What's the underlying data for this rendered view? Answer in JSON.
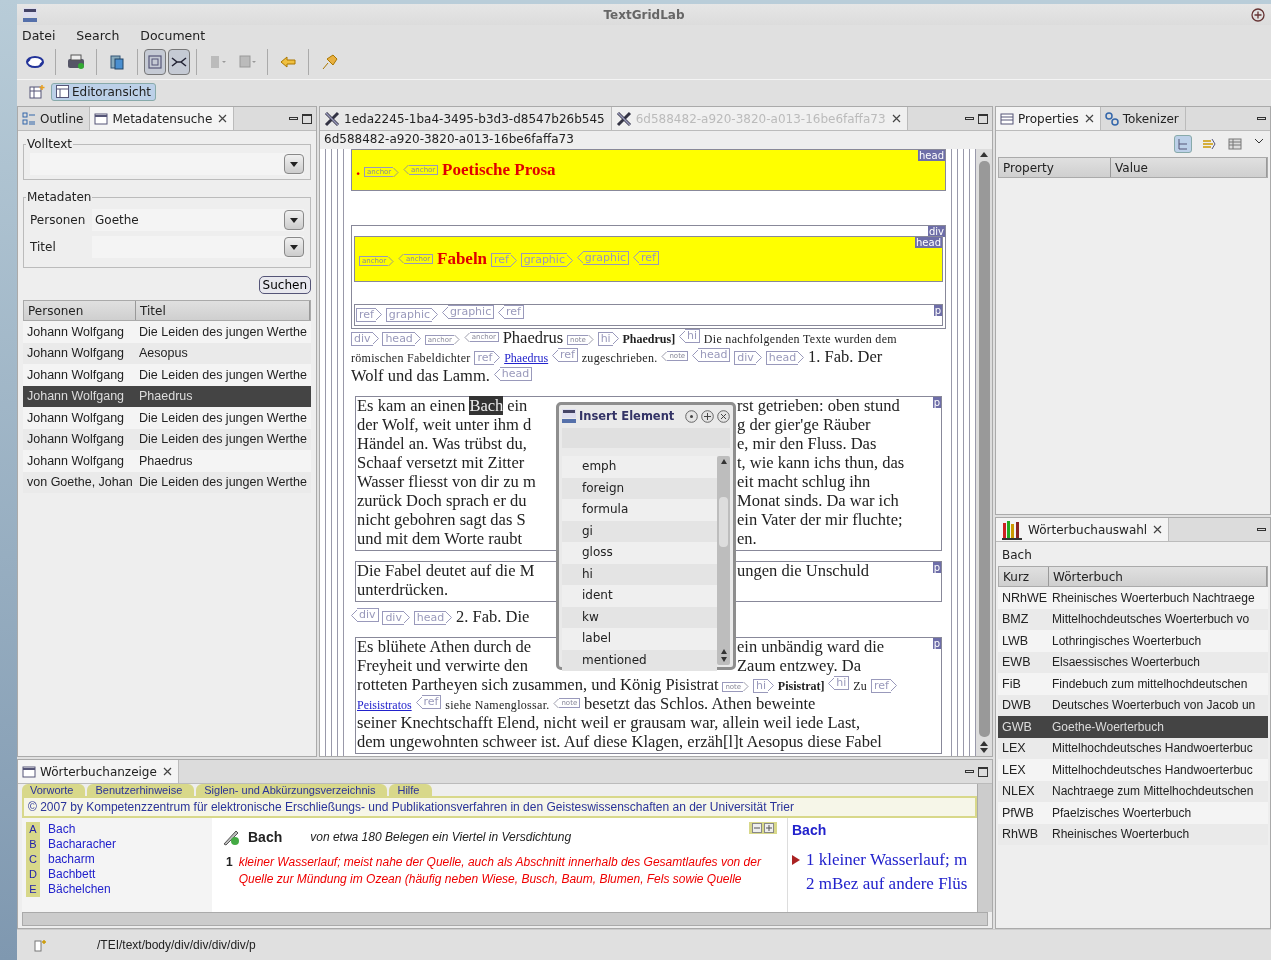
{
  "window": {
    "title": "TextGridLab"
  },
  "menu": [
    {
      "label": "Datei"
    },
    {
      "label": "Search"
    },
    {
      "label": "Document"
    }
  ],
  "toolbar": [
    {
      "kind": "sync",
      "pressed": false
    },
    {
      "kind": "print",
      "pressed": false
    },
    {
      "kind": "copy",
      "pressed": false
    },
    {
      "kind": "layout",
      "pressed": true
    },
    {
      "kind": "split",
      "pressed": true
    },
    {
      "kind": "tool",
      "pressed": false
    },
    {
      "kind": "tool2",
      "pressed": false
    },
    {
      "kind": "back",
      "pressed": false
    },
    {
      "kind": "pin",
      "pressed": false
    }
  ],
  "perspective": {
    "label": "Editoransicht",
    "selected": true
  },
  "left_panel": {
    "tabs": [
      {
        "label": "Outline",
        "selected": false
      },
      {
        "label": "Metadatensuche",
        "selected": true
      }
    ],
    "volltext": {
      "legend": "Volltext"
    },
    "metadaten": {
      "legend": "Metadaten",
      "fields": [
        {
          "label": "Personen",
          "value": "Goethe"
        },
        {
          "label": "Titel"
        }
      ]
    },
    "search_button": "Suchen",
    "table": {
      "columns": [
        "Personen",
        "Titel"
      ],
      "rows": [
        {
          "cells": [
            "Johann Wolfgang",
            "Die Leiden des jungen Werthe"
          ],
          "selected": false
        },
        {
          "cells": [
            "Johann Wolfgang",
            "Aesopus"
          ],
          "selected": false
        },
        {
          "cells": [
            "Johann Wolfgang",
            "Die Leiden des jungen Werthe"
          ],
          "selected": false
        },
        {
          "cells": [
            "Johann Wolfgang",
            "Phaedrus"
          ],
          "selected": true
        },
        {
          "cells": [
            "Johann Wolfgang",
            "Die Leiden des jungen Werthe"
          ],
          "selected": false
        },
        {
          "cells": [
            "Johann Wolfgang",
            "Die Leiden des jungen Werthe"
          ],
          "selected": false
        },
        {
          "cells": [
            "Johann Wolfgang",
            "Phaedrus"
          ],
          "selected": false
        },
        {
          "cells": [
            "von Goethe, Johan",
            "Die Leiden des jungen Werthe"
          ],
          "selected": false
        }
      ]
    }
  },
  "editor": {
    "tabs": [
      {
        "label": "1eda2245-1ba4-3495-b3d3-d8547b26b545",
        "selected": false
      },
      {
        "label": "6d588482-a920-3820-a013-16be6faffa73",
        "selected": true
      }
    ],
    "path": "6d588482-a920-3820-a013-16be6faffa73",
    "blocks": [
      {
        "kind": "head",
        "label": "head",
        "segments": [
          {
            "kind": "title",
            "text": "."
          },
          {
            "kind": "anchor",
            "closing": false,
            "text": "anchor"
          },
          {
            "kind": "anchor",
            "closing": true,
            "text": "anchor"
          },
          {
            "kind": "title",
            "text": "Poetische Prosa"
          }
        ]
      },
      {
        "kind": "div",
        "label": "div",
        "children": [
          {
            "kind": "head",
            "label": "head",
            "segments": [
              {
                "kind": "anchor",
                "closing": false,
                "text": "anchor"
              },
              {
                "kind": "anchor",
                "closing": true,
                "text": "anchor"
              },
              {
                "kind": "title",
                "text": "Fabeln"
              },
              {
                "kind": "tag",
                "closing": false,
                "text": "ref"
              },
              {
                "kind": "tag",
                "closing": false,
                "text": "graphic"
              },
              {
                "kind": "tag",
                "closing": true,
                "text": "graphic"
              },
              {
                "kind": "tag",
                "closing": true,
                "text": "ref"
              }
            ]
          },
          {
            "kind": "p",
            "label": "p",
            "segments": [
              {
                "kind": "tag",
                "closing": false,
                "text": "ref"
              },
              {
                "kind": "tag",
                "closing": false,
                "text": "graphic"
              },
              {
                "kind": "tag",
                "closing": true,
                "text": "graphic"
              },
              {
                "kind": "tag",
                "closing": true,
                "text": "ref"
              }
            ]
          }
        ]
      },
      {
        "kind": "flow",
        "segments": [
          {
            "kind": "tag",
            "closing": false,
            "text": "div"
          },
          {
            "kind": "tag",
            "closing": false,
            "text": "head"
          },
          {
            "kind": "anchor",
            "closing": false,
            "text": "anchor"
          },
          {
            "kind": "anchor",
            "closing": true,
            "text": "anchor"
          },
          {
            "kind": "big",
            "text": "Phaedrus"
          },
          {
            "kind": "anchor",
            "closing": false,
            "text": "note"
          },
          {
            "kind": "tag",
            "closing": false,
            "text": "hi"
          },
          {
            "kind": "bold",
            "text": "Phaedrus]"
          },
          {
            "kind": "tag",
            "closing": true,
            "text": "hi"
          },
          {
            "kind": "text",
            "text": "Die nachfolgenden Texte wurden dem"
          },
          {
            "kind": "text",
            "text": "römischen Fabeldichter"
          },
          {
            "kind": "tag",
            "closing": false,
            "text": "ref"
          },
          {
            "kind": "link",
            "text": "Phaedrus"
          },
          {
            "kind": "tag",
            "closing": true,
            "text": "ref"
          },
          {
            "kind": "text",
            "text": "zugeschrieben."
          },
          {
            "kind": "anchor",
            "closing": true,
            "text": "note"
          },
          {
            "kind": "tag",
            "closing": true,
            "text": "head"
          },
          {
            "kind": "tag",
            "closing": false,
            "text": "div"
          },
          {
            "kind": "tag",
            "closing": false,
            "text": "head"
          },
          {
            "kind": "big",
            "text": "1. Fab. Der"
          },
          {
            "kind": "big",
            "text": "Wolf und das Lamm."
          },
          {
            "kind": "tag",
            "closing": true,
            "text": "head"
          }
        ]
      },
      {
        "kind": "p",
        "label": "p",
        "lines": [
          {
            "left": [
              {
                "kind": "big",
                "text": "Es kam an einen"
              },
              {
                "kind": "mark",
                "text": "Bach"
              },
              {
                "kind": "big",
                "text": "ein"
              }
            ],
            "right": [
              {
                "kind": "big",
                "text": "rst getrieben: oben stund"
              }
            ]
          },
          {
            "left": [
              {
                "kind": "big",
                "text": "der Wolf, weit unter ihm d"
              }
            ],
            "right": [
              {
                "kind": "big",
                "text": "g der gier'ge Räuber"
              }
            ]
          },
          {
            "left": [
              {
                "kind": "big",
                "text": "Händel an. Was trübst du,"
              }
            ],
            "right": [
              {
                "kind": "big",
                "text": "e, mir den Fluss. Das"
              }
            ]
          },
          {
            "left": [
              {
                "kind": "big",
                "text": "Schaaf versetzt mit Zitter"
              }
            ],
            "right": [
              {
                "kind": "big",
                "text": "t, wie kann ichs thun, das"
              }
            ]
          },
          {
            "left": [
              {
                "kind": "big",
                "text": "Wasser fliesst von dir zu m"
              }
            ],
            "right": [
              {
                "kind": "big",
                "text": "eit macht schlug ihn"
              }
            ]
          },
          {
            "left": [
              {
                "kind": "big",
                "text": "zurück Doch sprach er du"
              }
            ],
            "right": [
              {
                "kind": "big",
                "text": "Monat sinds. Da war ich"
              }
            ]
          },
          {
            "left": [
              {
                "kind": "big",
                "text": "nicht gebohren sagt das S"
              }
            ],
            "right": [
              {
                "kind": "big",
                "text": "ein Vater der mir fluchte;"
              }
            ]
          },
          {
            "left": [
              {
                "kind": "big",
                "text": "und mit dem Worte raubt"
              }
            ],
            "right": [
              {
                "kind": "big",
                "text": "en."
              }
            ]
          }
        ]
      },
      {
        "kind": "p",
        "label": "p",
        "lines": [
          {
            "left": [
              {
                "kind": "big",
                "text": "Die Fabel deutet auf die M"
              }
            ],
            "right": [
              {
                "kind": "big",
                "text": "ungen die Unschuld"
              }
            ]
          },
          {
            "left": [
              {
                "kind": "big",
                "text": "unterdrücken."
              }
            ]
          }
        ]
      },
      {
        "kind": "flow",
        "segments": [
          {
            "kind": "tag",
            "closing": true,
            "text": "div"
          },
          {
            "kind": "tag",
            "closing": false,
            "text": "div"
          },
          {
            "kind": "tag",
            "closing": false,
            "text": "head"
          },
          {
            "kind": "big",
            "text": "2. Fab. Die"
          }
        ]
      },
      {
        "kind": "p",
        "label": "p",
        "lines": [
          {
            "left": [
              {
                "kind": "big",
                "text": "Es blühete Athen durch de"
              }
            ],
            "right": [
              {
                "kind": "big",
                "text": "ein unbändig ward die"
              }
            ]
          },
          {
            "left": [
              {
                "kind": "big",
                "text": "Freyheit und verwirte den"
              }
            ],
            "right": [
              {
                "kind": "big",
                "text": "Zaum entzwey. Da"
              }
            ]
          }
        ],
        "segments": [
          {
            "kind": "big",
            "text": "rotteten Partheyen sich zusammen, und König Pisistrat"
          },
          {
            "kind": "anchor",
            "closing": false,
            "text": "note"
          },
          {
            "kind": "tag",
            "closing": false,
            "text": "hi"
          },
          {
            "kind": "bold",
            "text": "Pisistrat]"
          },
          {
            "kind": "tag",
            "closing": true,
            "text": "hi"
          },
          {
            "kind": "text",
            "text": "Zu"
          },
          {
            "kind": "tag",
            "closing": false,
            "text": "ref"
          },
          {
            "kind": "link",
            "text": "Peisistratos"
          },
          {
            "kind": "tag",
            "closing": true,
            "text": "ref"
          },
          {
            "kind": "text",
            "text": "siehe Namenglossar."
          },
          {
            "kind": "anchor",
            "closing": true,
            "text": "note"
          },
          {
            "kind": "big",
            "text": "besetzt das Schlos. Athen beweinte"
          },
          {
            "kind": "big",
            "text": "seiner Knechtschafft Elend, nicht weil er grausam war, allein weil iede Last,"
          },
          {
            "kind": "big",
            "text": "dem ungewohnten schweer ist. Auf diese Klagen, erzäh[l]t Aesopus diese"
          },
          {
            "kind": "big",
            "text": "Fabel"
          }
        ]
      }
    ],
    "popup": {
      "title": "Insert Element",
      "items": [
        "emph",
        "foreign",
        "formula",
        "gi",
        "gloss",
        "hi",
        "ident",
        "kw",
        "label",
        "mentioned"
      ]
    }
  },
  "properties": {
    "tabs": [
      {
        "label": "Properties",
        "selected": true
      },
      {
        "label": "Tokenizer",
        "selected": false
      }
    ],
    "columns": [
      "Property",
      "Value"
    ]
  },
  "dictionary_select": {
    "tab": "Wörterbuchauswahl",
    "query": "Bach",
    "columns": [
      "Kurz",
      "Wörterbuch"
    ],
    "rows": [
      {
        "cells": [
          "NRhWE",
          "Rheinisches Woerterbuch Nachtraege"
        ],
        "selected": false
      },
      {
        "cells": [
          "BMZ",
          "Mittelhochdeutsches Woerterbuch vo"
        ],
        "selected": false
      },
      {
        "cells": [
          "LWB",
          "Lothringisches Woerterbuch"
        ],
        "selected": false
      },
      {
        "cells": [
          "EWB",
          "Elsaessisches Woerterbuch"
        ],
        "selected": false
      },
      {
        "cells": [
          "FiB",
          "Findebuch zum mittelhochdeutschen"
        ],
        "selected": false
      },
      {
        "cells": [
          "DWB",
          "Deutsches Woerterbuch von Jacob un"
        ],
        "selected": false
      },
      {
        "cells": [
          "GWB",
          "Goethe-Woerterbuch"
        ],
        "selected": true
      },
      {
        "cells": [
          "LEX",
          "Mittelhochdeutsches Handwoerterbuc"
        ],
        "selected": false
      },
      {
        "cells": [
          "LEX",
          "Mittelhochdeutsches Handwoerterbuc"
        ],
        "selected": false
      },
      {
        "cells": [
          "NLEX",
          "Nachtraege zum Mittelhochdeutschen"
        ],
        "selected": false
      },
      {
        "cells": [
          "PfWB",
          "Pfaelzisches Woerterbuch"
        ],
        "selected": false
      },
      {
        "cells": [
          "RhWB",
          "Rheinisches Woerterbuch"
        ],
        "selected": false
      }
    ]
  },
  "dictionary_view": {
    "tab": "Wörterbuchanzeige",
    "links": [
      "Vorworte",
      "Benutzerhinweise",
      "Siglen- und Abkürzungsverzeichnis",
      "Hilfe"
    ],
    "copyright": "© 2007 by Kompetenzzentrum für elektronische Erschließungs- und Publikationsverfahren in den Geisteswissenschaften an der Universität Trier",
    "lemmas": [
      {
        "letter": "A",
        "word": "Bach"
      },
      {
        "letter": "B",
        "word": "Bacharacher"
      },
      {
        "letter": "C",
        "word": "bacharm"
      },
      {
        "letter": "D",
        "word": "Bachbett"
      },
      {
        "letter": "E",
        "word": "Bächelchen"
      }
    ],
    "article": {
      "lemma": "Bach",
      "note": "von etwa 180 Belegen ein Viertel in Versdichtung",
      "sense_number": "1",
      "sense": "kleiner Wasserlauf; meist nahe der Quelle, auch als Abschnitt innerhalb des Gesamtlaufes von der Quelle zur Mündung im Ozean (häufig neben Wiese, Busch, Baum, Blumen, Fels sowie Quelle"
    },
    "outline": {
      "lemma": "Bach",
      "senses": [
        {
          "text": "1 kleiner Wasserlauf; m",
          "current": true
        },
        {
          "text": "2 mBez auf andere Flüs",
          "current": false
        }
      ]
    }
  },
  "status_bar": {
    "path": "/TEI/text/body/div/div/div/div/p"
  }
}
